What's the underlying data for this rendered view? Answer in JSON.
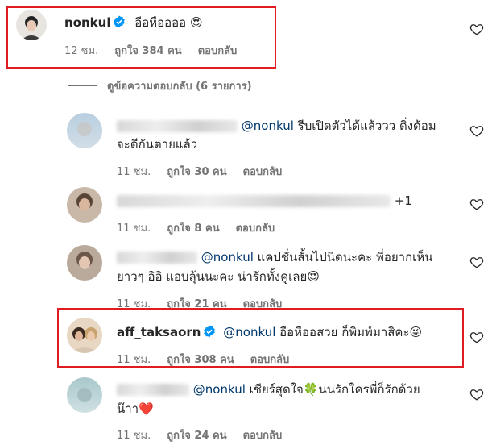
{
  "top_comment": {
    "username": "nonkul",
    "text": "อือหืออออ 😍",
    "time": "12 ชม.",
    "likes": "ถูกใจ 384 คน",
    "reply": "ตอบกลับ"
  },
  "view_replies": "ดูข้อความตอบกลับ (6 รายการ)",
  "replies": [
    {
      "mention": "@nonkul",
      "text_line1": "รีบเปิดตัวได้แล้ววว ดิ่งด้อม",
      "text_line2": "จะดีกันตายแล้ว",
      "time": "11 ชม.",
      "likes": "ถูกใจ 30 คน",
      "reply": "ตอบกลับ"
    },
    {
      "text_line1": "+1",
      "time": "11 ชม.",
      "likes": "ถูกใจ 8 คน",
      "reply": "ตอบกลับ"
    },
    {
      "mention": "@nonkul",
      "text_line1": "แคปชั่นสั้นไปนิดนะคะ พี่อยากเห็น",
      "text_line2": "ยาวๆ อิอิ แอบลุ้นนะคะ น่ารักทั้งคู่เลย😍",
      "time": "11 ชม.",
      "likes": "ถูกใจ 21 คน",
      "reply": "ตอบกลับ"
    },
    {
      "username": "aff_taksaorn",
      "mention": "@nonkul",
      "text_line1": "อือหืออสวย ก็พิมพ์มาสิคะ😜",
      "time": "11 ชม.",
      "likes": "ถูกใจ 308 คน",
      "reply": "ตอบกลับ"
    },
    {
      "mention": "@nonkul",
      "text_line1": "เชียร์สุดใจ🍀นนรักใครพี่ก็รักด้วย",
      "text_line2": "น๊าา❤️",
      "time": "11 ชม.",
      "likes": "ถูกใจ 24 คน",
      "reply": "ตอบกลับ"
    }
  ],
  "colors": {
    "highlight": "#e11b22",
    "verified": "#0095f6",
    "mention": "#00376b",
    "meta": "#737373"
  }
}
